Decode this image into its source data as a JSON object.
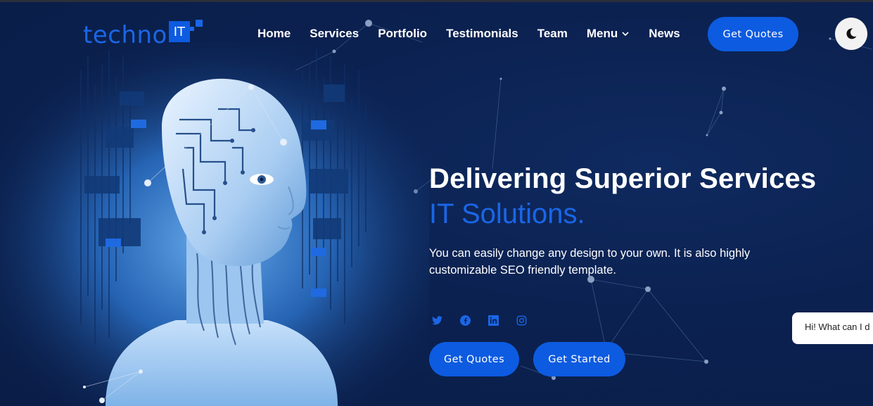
{
  "brand": {
    "name": "techno",
    "badge": "IT"
  },
  "nav": {
    "items": [
      {
        "label": "Home"
      },
      {
        "label": "Services"
      },
      {
        "label": "Portfolio"
      },
      {
        "label": "Testimonials"
      },
      {
        "label": "Team"
      },
      {
        "label": "Menu",
        "has_dropdown": true
      },
      {
        "label": "News"
      }
    ],
    "cta_label": "Get Quotes"
  },
  "theme_toggle": {
    "icon": "moon-icon"
  },
  "hero": {
    "title": "Delivering Superior Services",
    "subtitle": "IT Solutions.",
    "description": "You can easily change any design to your own. It is also highly customizable SEO friendly template.",
    "socials": [
      "twitter-icon",
      "facebook-icon",
      "linkedin-icon",
      "instagram-icon"
    ],
    "primary_button": "Get Quotes",
    "secondary_button": "Get Started"
  },
  "chat": {
    "text": "Hi! What can I d"
  },
  "colors": {
    "background": "#0b2150",
    "accent": "#0d5be0",
    "accent_text": "#1a66e6"
  }
}
